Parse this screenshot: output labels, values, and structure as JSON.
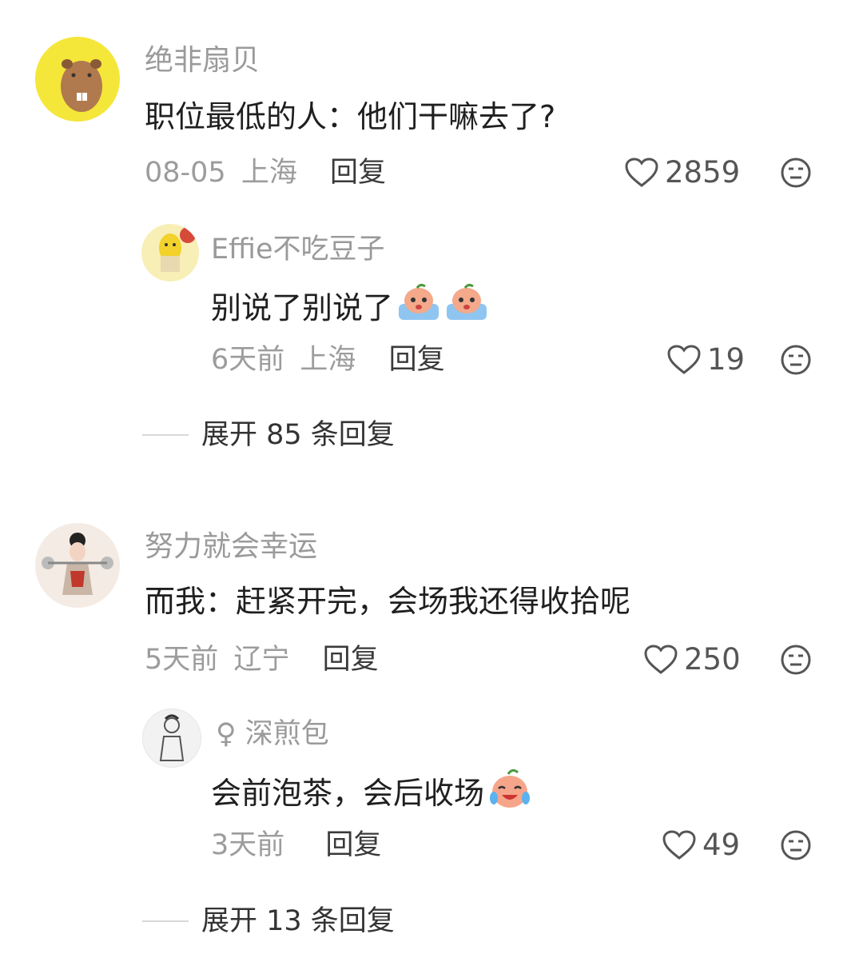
{
  "comments": [
    {
      "username": "绝非扇贝",
      "text": "职位最低的人：他们干嘛去了?",
      "date": "08-05",
      "location": "上海",
      "reply_label": "回复",
      "likes": "2859",
      "replies": [
        {
          "username": "Effie不吃豆子",
          "text": "别说了别说了",
          "emoji": [
            "crying-peach-emoji",
            "crying-peach-emoji"
          ],
          "date": "6天前",
          "location": "上海",
          "reply_label": "回复",
          "likes": "19"
        }
      ],
      "expand_label": "展开 85 条回复"
    },
    {
      "username": "努力就会幸运",
      "text": "而我：赶紧开完，会场我还得收拾呢",
      "date": "5天前",
      "location": "辽宁",
      "reply_label": "回复",
      "likes": "250",
      "replies": [
        {
          "gender_symbol": "♀",
          "username": "深煎包",
          "text": "会前泡茶，会后收场",
          "emoji": [
            "crying-laugh-peach-emoji"
          ],
          "date": "3天前",
          "location": "",
          "reply_label": "回复",
          "likes": "49"
        }
      ],
      "expand_label": "展开 13 条回复"
    }
  ]
}
